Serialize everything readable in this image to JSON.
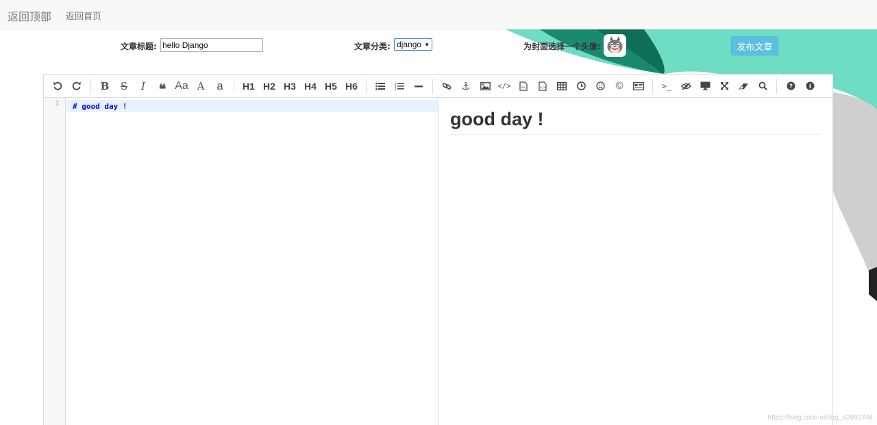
{
  "navbar": {
    "brand": "返回顶部",
    "home_link": "返回首页"
  },
  "form": {
    "title_label": "文章标题:",
    "title_value": "hello Django",
    "category_label": "文章分类:",
    "category_value": "django",
    "avatar_label": "为封面选择一个头像:",
    "publish_button": "发布文章"
  },
  "toolbar": {
    "headings": [
      "H1",
      "H2",
      "H3",
      "H4",
      "H5",
      "H6"
    ],
    "case_labels": {
      "ucwords": "Aa",
      "uppercase": "A",
      "lowercase": "a"
    },
    "icons": [
      "undo-icon",
      "redo-icon",
      "bold-icon",
      "strikethrough-icon",
      "italic-icon",
      "quote-icon",
      "ucwords-icon",
      "uppercase-icon",
      "lowercase-icon",
      "h1",
      "h2",
      "h3",
      "h4",
      "h5",
      "h6",
      "list-ul-icon",
      "list-ol-icon",
      "hr-icon",
      "link-icon",
      "anchor-icon",
      "image-icon",
      "code-icon",
      "preformatted-text-icon",
      "code-block-icon",
      "table-icon",
      "datetime-icon",
      "emoji-icon",
      "html-entities-icon",
      "pagebreak-icon",
      "goto-line-icon",
      "watch-icon",
      "preview-icon",
      "fullscreen-icon",
      "clear-icon",
      "search-icon",
      "help-icon",
      "info-icon"
    ]
  },
  "editor": {
    "line_number": "1",
    "markdown": "# good day !",
    "preview_heading": "good day !"
  },
  "watermark": "https://blog.csdn.net/qq_42992704",
  "colors": {
    "accent_teal": "#6fdcc4",
    "dark_teal": "#1a8a6e",
    "publish_button": "#5bc0de",
    "code_text": "#0000ff",
    "active_line": "#e8f2ff"
  }
}
